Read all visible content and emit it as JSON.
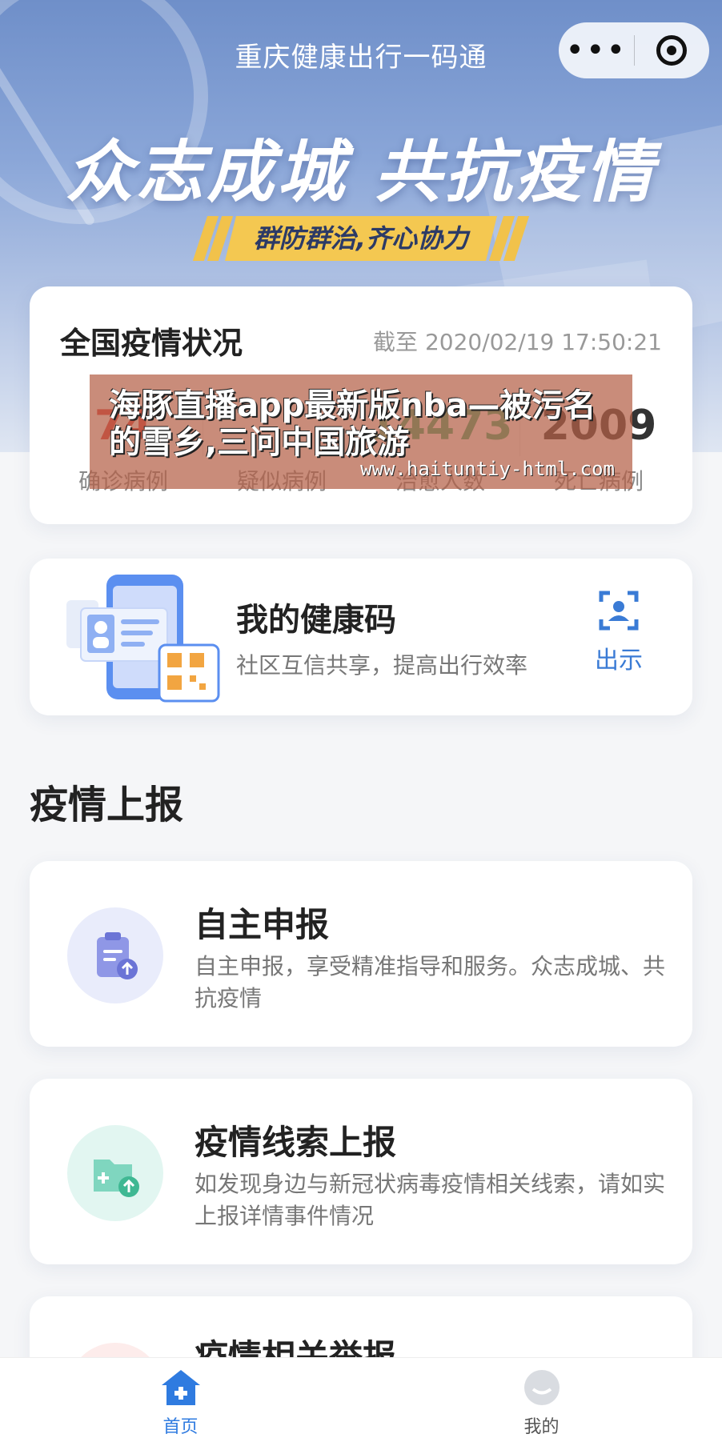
{
  "header": {
    "title": "重庆健康出行一码通",
    "more_label": "•••"
  },
  "banner": {
    "slogan": "众志成城 共抗疫情",
    "subtitle": "群防群治,齐心协力"
  },
  "stats": {
    "title": "全国疫情状况",
    "timestamp": "截至 2020/02/19 17:50:21",
    "items": [
      {
        "value": "74",
        "label": "确诊病例",
        "color": "#e2393c"
      },
      {
        "value": "",
        "label": "疑似病例",
        "color": "#f1a43a"
      },
      {
        "value": "14473",
        "label": "治愈人数",
        "color": "#3ab27a"
      },
      {
        "value": "2009",
        "label": "死亡病例",
        "color": "#333333"
      }
    ]
  },
  "overlay": {
    "title": "海豚直播app最新版nba—被污名的雪乡,三问中国旅游",
    "url": "www.haituntiy-html.com"
  },
  "health_code": {
    "title": "我的健康码",
    "subtitle": "社区互信共享，提高出行效率",
    "action_label": "出示",
    "icon": "scan-face-icon"
  },
  "report_section": {
    "title": "疫情上报",
    "cards": [
      {
        "title": "自主申报",
        "desc": "自主申报，享受精准指导和服务。众志成城、共抗疫情",
        "icon": "clipboard-upload-icon",
        "color": "#e9ecfb"
      },
      {
        "title": "疫情线索上报",
        "desc": "如发现身边与新冠状病毒疫情相关线索，请如实上报详情事件情况",
        "icon": "folder-upload-icon",
        "color": "#e2f6f1"
      },
      {
        "title": "疫情相关举报",
        "desc": "",
        "icon": "report-icon",
        "color": "#fdeceb"
      }
    ]
  },
  "tabbar": {
    "items": [
      {
        "label": "首页",
        "icon": "home-icon",
        "active": true
      },
      {
        "label": "我的",
        "icon": "profile-icon",
        "active": false
      }
    ],
    "active_color": "#2f7be0"
  }
}
